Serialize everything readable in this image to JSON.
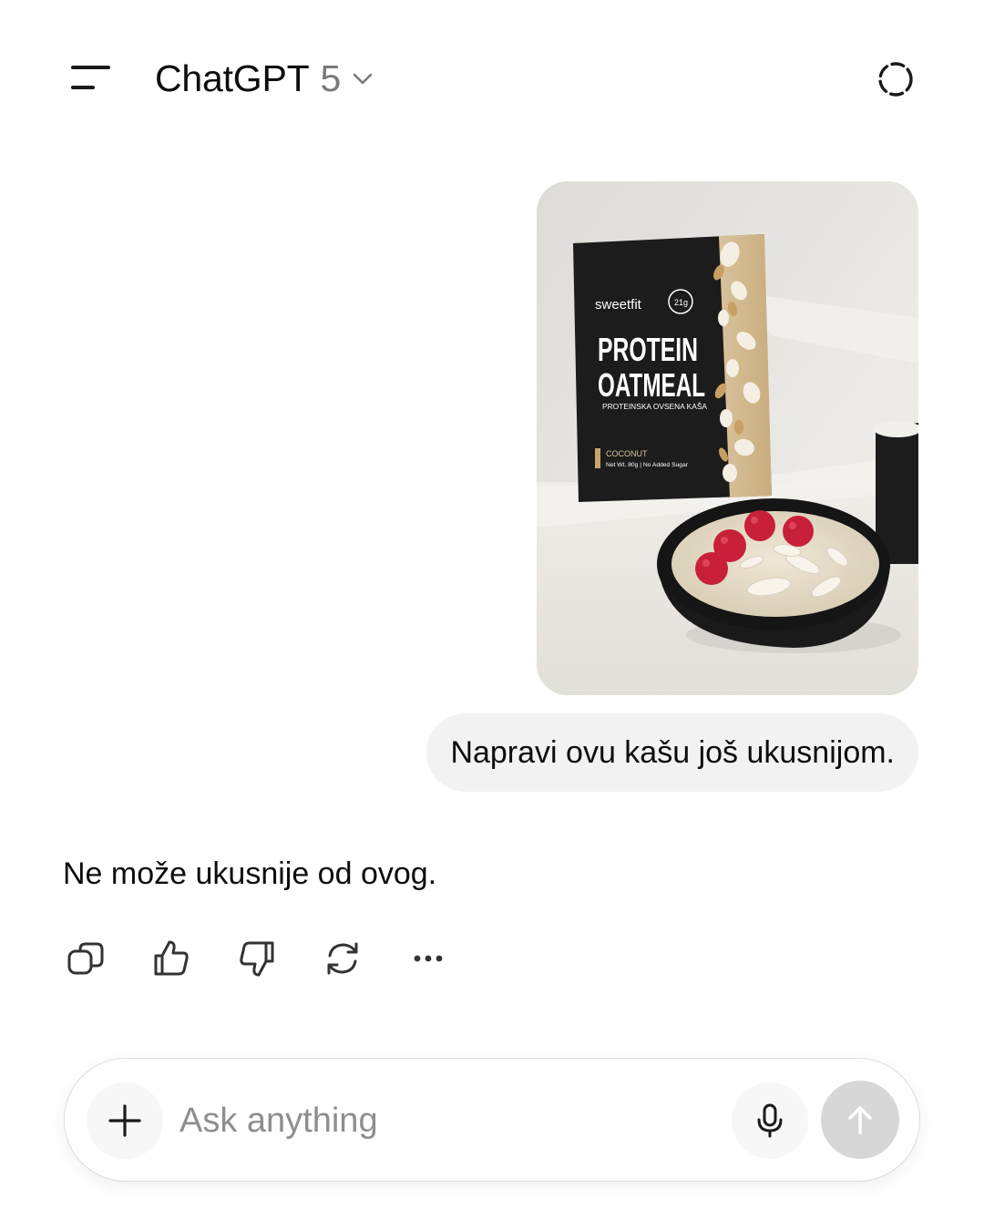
{
  "header": {
    "title": "ChatGPT",
    "model_version": "5",
    "menu_icon": "menu-icon",
    "temporary_chat_icon": "temporary-chat-icon"
  },
  "conversation": {
    "user_image": {
      "brand": "sweetfit",
      "badge": "21g",
      "product_line1": "PROTEIN",
      "product_line2": "OATMEAL",
      "product_subtitle": "PROTEINSKA OVSENA KAŠA",
      "flavor": "COCONUT",
      "net_weight": "Net Wt. 80g | No Added Sugar"
    },
    "user_message": "Napravi ovu kašu još ukusnijom.",
    "assistant_message": "Ne može ukusnije od ovog.",
    "actions": [
      {
        "name": "copy-icon"
      },
      {
        "name": "thumbs-up-icon"
      },
      {
        "name": "thumbs-down-icon"
      },
      {
        "name": "regenerate-icon"
      },
      {
        "name": "more-icon"
      }
    ]
  },
  "composer": {
    "placeholder": "Ask anything",
    "value": ""
  },
  "colors": {
    "text": "#0d0d0d",
    "muted": "#7a7a7a",
    "bubble": "#f2f2f2",
    "send_disabled": "#d7d7d7"
  }
}
